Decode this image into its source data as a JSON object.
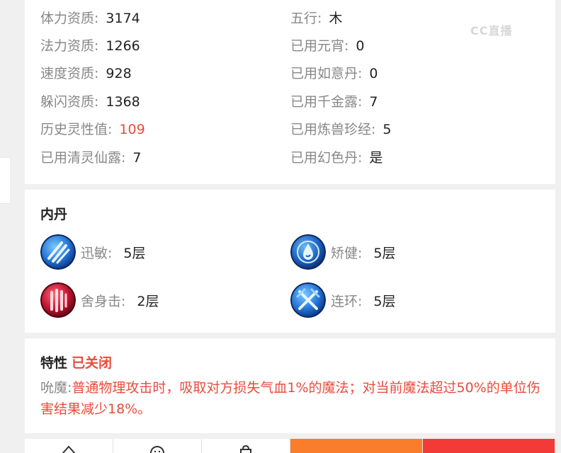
{
  "watermark": {
    "text": "CC直播"
  },
  "stats": {
    "left": [
      {
        "label": "体力资质:",
        "value": "3174"
      },
      {
        "label": "法力资质:",
        "value": "1266"
      },
      {
        "label": "速度资质:",
        "value": "928"
      },
      {
        "label": "躲闪资质:",
        "value": "1368"
      },
      {
        "label": "历史灵性值:",
        "value": "109",
        "highlight": "#e94b3c"
      },
      {
        "label": "已用清灵仙露:",
        "value": "7"
      }
    ],
    "right": [
      {
        "label": "五行:",
        "value": "木"
      },
      {
        "label": "已用元宵:",
        "value": "0"
      },
      {
        "label": "已用如意丹:",
        "value": "0"
      },
      {
        "label": "已用千金露:",
        "value": "7"
      },
      {
        "label": "已用炼兽珍经:",
        "value": "5"
      },
      {
        "label": "已用幻色丹:",
        "value": "是"
      }
    ]
  },
  "neidan": {
    "title": "内丹",
    "items": [
      {
        "icon": "claw-blue-icon",
        "name": "迅敏:",
        "level": "5层"
      },
      {
        "icon": "water-drop-blue-icon",
        "name": "矫健:",
        "level": "5层"
      },
      {
        "icon": "claw-red-icon",
        "name": "舍身击:",
        "level": "2层"
      },
      {
        "icon": "crossed-swords-blue-icon",
        "name": "连环:",
        "level": "5层"
      }
    ]
  },
  "trait": {
    "label": "特性",
    "status": "已关闭",
    "name": "吮魔:",
    "description": "普通物理攻击时，吸取对方损失气血1%的魔法；对当前魔法超过50%的单位伤害结果减少18%。"
  },
  "bottom_bar": {
    "buttons": [
      {
        "icon": "home-icon"
      },
      {
        "icon": "smile-icon"
      },
      {
        "icon": "bag-icon"
      }
    ]
  },
  "colors": {
    "accent_red": "#e94b3c",
    "orange_button": "#fa7d2c",
    "red_button": "#f23a36"
  }
}
